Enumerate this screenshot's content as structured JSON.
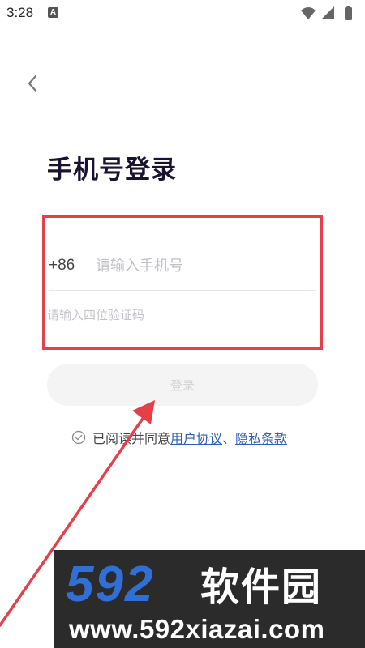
{
  "status_bar": {
    "time": "3:28",
    "notification_badge": "A",
    "icons": [
      "wifi-icon",
      "signal-icon",
      "battery-icon"
    ]
  },
  "header": {
    "back_icon": "chevron-left-icon"
  },
  "page": {
    "title": "手机号登录"
  },
  "form": {
    "country_code": "+86",
    "phone_placeholder": "请输入手机号",
    "phone_value": "",
    "code_placeholder": "请输入四位验证码",
    "code_value": "",
    "login_label": "登录"
  },
  "agreement": {
    "check_icon": "check-circle-icon",
    "prefix": "已阅读并同意",
    "user_agreement": "用户协议",
    "separator": "、",
    "privacy_policy": "隐私条款"
  },
  "watermark": {
    "number": "592",
    "name": "软件园",
    "url": "www.592xiazai.com"
  },
  "colors": {
    "title": "#1a1230",
    "highlight_box": "#e5404a",
    "link": "#2f5fb8",
    "login_button_bg": "#f4f4f5",
    "watermark_bg": "#2b2b2b",
    "watermark_number": "#2f6fd6"
  }
}
